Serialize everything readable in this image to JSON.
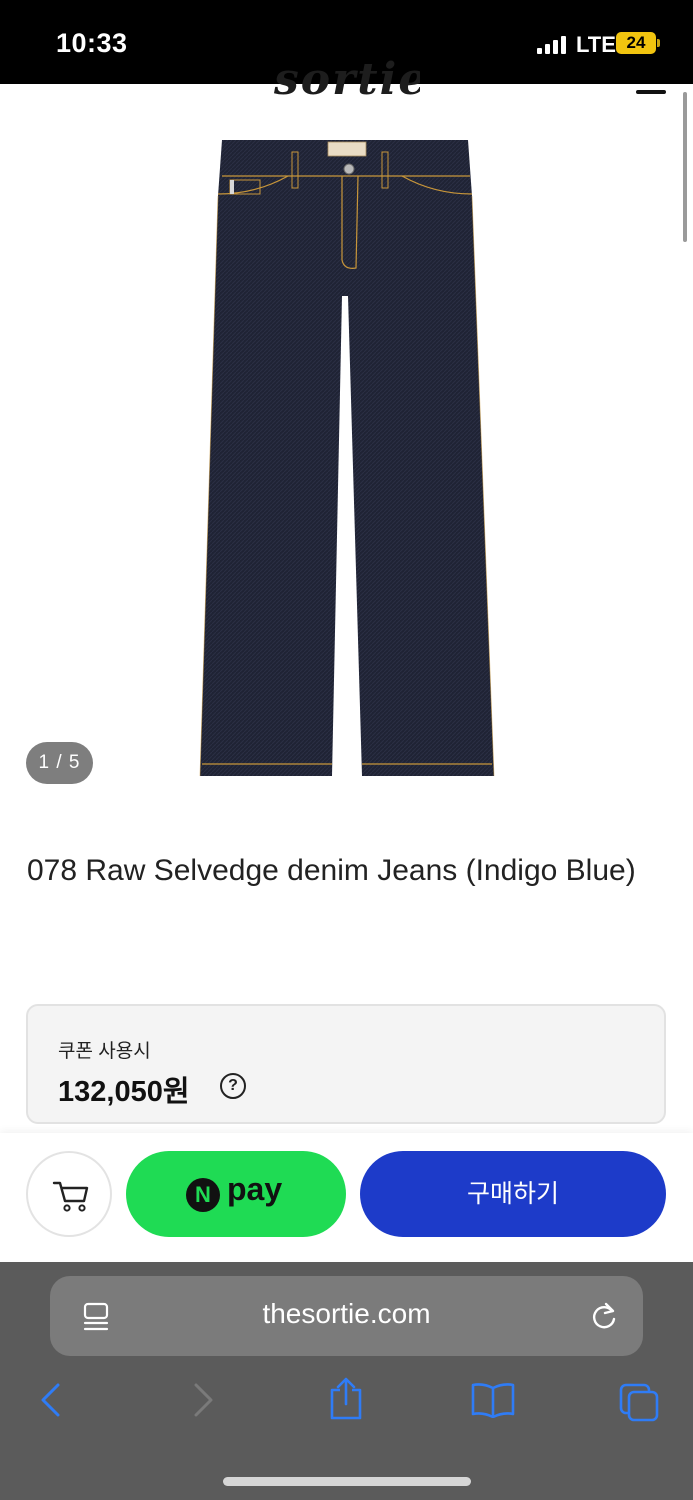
{
  "status_bar": {
    "time": "10:33",
    "network": "LTE",
    "battery": "24"
  },
  "header": {
    "logo": "sortie"
  },
  "gallery": {
    "counter": "1 / 5"
  },
  "product": {
    "title": "078 Raw Selvedge denim Jeans (Indigo Blue)"
  },
  "coupon": {
    "label": "쿠폰 사용시",
    "price": "132,050원",
    "help": "?"
  },
  "actions": {
    "npay_badge": "N",
    "npay_label": "pay",
    "buy_label": "구매하기"
  },
  "browser": {
    "url": "thesortie.com"
  },
  "colors": {
    "npay_green": "#1fdb54",
    "buy_blue": "#1d3bc9",
    "denim": "#1f2334"
  }
}
